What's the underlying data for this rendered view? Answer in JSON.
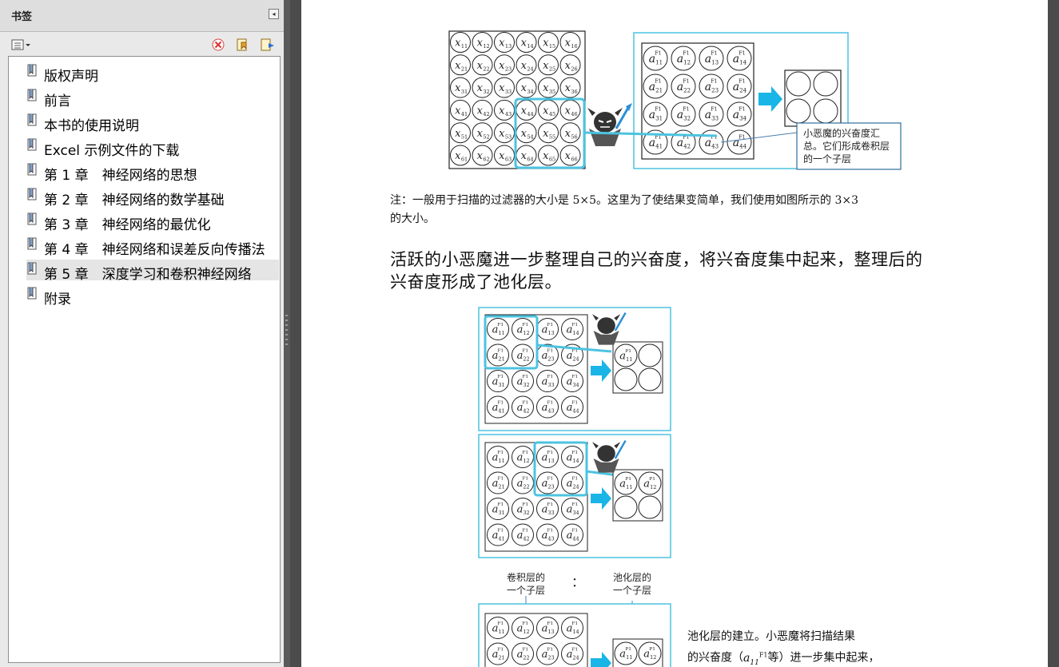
{
  "panel": {
    "title": "书签",
    "collapse_glyph": "◂",
    "toolbar": {
      "options_icon": "bookmark-options-icon",
      "delete_icon": "delete-bookmark-icon",
      "new_icon": "new-bookmark-icon",
      "expand_icon": "expand-bookmark-icon"
    },
    "bookmarks": [
      {
        "label": "版权声明",
        "selected": false
      },
      {
        "label": "前言",
        "selected": false
      },
      {
        "label": "本书的使用说明",
        "selected": false
      },
      {
        "label": "Excel 示例文件的下载",
        "selected": false
      },
      {
        "label": "第 1 章　神经网络的思想",
        "selected": false
      },
      {
        "label": "第 2 章　神经网络的数学基础",
        "selected": false
      },
      {
        "label": "第 3 章　神经网络的最优化",
        "selected": false
      },
      {
        "label": "第 4 章　神经网络和误差反向传播法",
        "selected": false
      },
      {
        "label": "第 5 章　深度学习和卷积神经网络",
        "selected": true
      },
      {
        "label": "附录",
        "selected": false
      }
    ]
  },
  "document": {
    "fig1_callout": [
      "小恶魔的兴奋度汇",
      "总。它们形成卷积层",
      "的一个子层"
    ],
    "note_line1": "注：一般用于扫描的过滤器的大小是 5×5。这里为了使结果变简单，我们使用如图所示的 3×3",
    "note_line2": "的大小。",
    "para_line1": "活跃的小恶魔进一步整理自己的兴奋度，将兴奋度集中起来，整理后的",
    "para_line2": "兴奋度形成了池化层。",
    "label_conv": [
      "卷积层的",
      "一个子层"
    ],
    "label_colon": "：",
    "label_pool": [
      "池化层的",
      "一个子层"
    ],
    "side_caption_line1": "池化层的建立。小恶魔将扫描结果",
    "side_caption_line2_a": "的兴奋度（",
    "side_caption_line2_b": "等）进一步集中起来，",
    "x_grid": [
      [
        "11",
        "12",
        "13",
        "14",
        "15",
        "16"
      ],
      [
        "21",
        "22",
        "23",
        "24",
        "25",
        "26"
      ],
      [
        "31",
        "32",
        "33",
        "34",
        "35",
        "36"
      ],
      [
        "41",
        "42",
        "43",
        "44",
        "45",
        "46"
      ],
      [
        "51",
        "52",
        "53",
        "54",
        "55",
        "56"
      ],
      [
        "61",
        "62",
        "63",
        "64",
        "65",
        "66"
      ]
    ],
    "a_grid": [
      [
        "11",
        "12",
        "13",
        "14"
      ],
      [
        "21",
        "22",
        "23",
        "24"
      ],
      [
        "31",
        "32",
        "33",
        "34"
      ],
      [
        "41",
        "42",
        "43",
        "44"
      ]
    ],
    "var_x": "x",
    "var_a": "a",
    "sup_f": "F1",
    "sup_p": "P1",
    "pool_out_first": [
      "11"
    ],
    "pool_out_second": [
      "11",
      "12"
    ],
    "pool_out_third": [
      "11",
      "12"
    ],
    "accent_color": "#4cc3e0",
    "arrow_color": "#19b5e6"
  }
}
